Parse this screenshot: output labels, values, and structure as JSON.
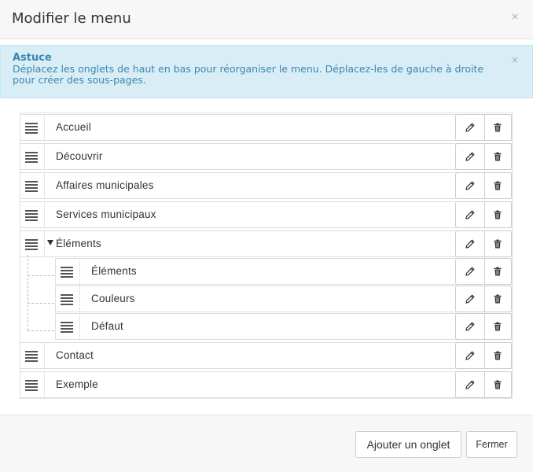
{
  "modal": {
    "title": "Modifier le menu"
  },
  "alert": {
    "title": "Astuce",
    "message": "Déplacez les onglets de haut en bas pour réorganiser le menu. Déplacez-les de gauche à droite pour créer des sous-pages."
  },
  "menu": {
    "items": [
      {
        "label": "Accueil"
      },
      {
        "label": "Découvrir"
      },
      {
        "label": "Affaires municipales"
      },
      {
        "label": "Services municipaux"
      },
      {
        "label": "Éléments",
        "expanded": true
      },
      {
        "label": "Éléments",
        "child": true
      },
      {
        "label": "Couleurs",
        "child": true
      },
      {
        "label": "Défaut",
        "child": true
      },
      {
        "label": "Contact"
      },
      {
        "label": "Exemple"
      }
    ]
  },
  "footer": {
    "add_tab_label": "Ajouter un onglet",
    "close_label": "Fermer"
  },
  "icons": {
    "close": "close-icon",
    "drag": "drag-handle-icon",
    "edit": "pencil-icon",
    "delete": "trash-icon",
    "expand": "caret-down-icon"
  },
  "colors": {
    "alert_text": "#3a87ad",
    "alert_background": "#d9edf7"
  }
}
